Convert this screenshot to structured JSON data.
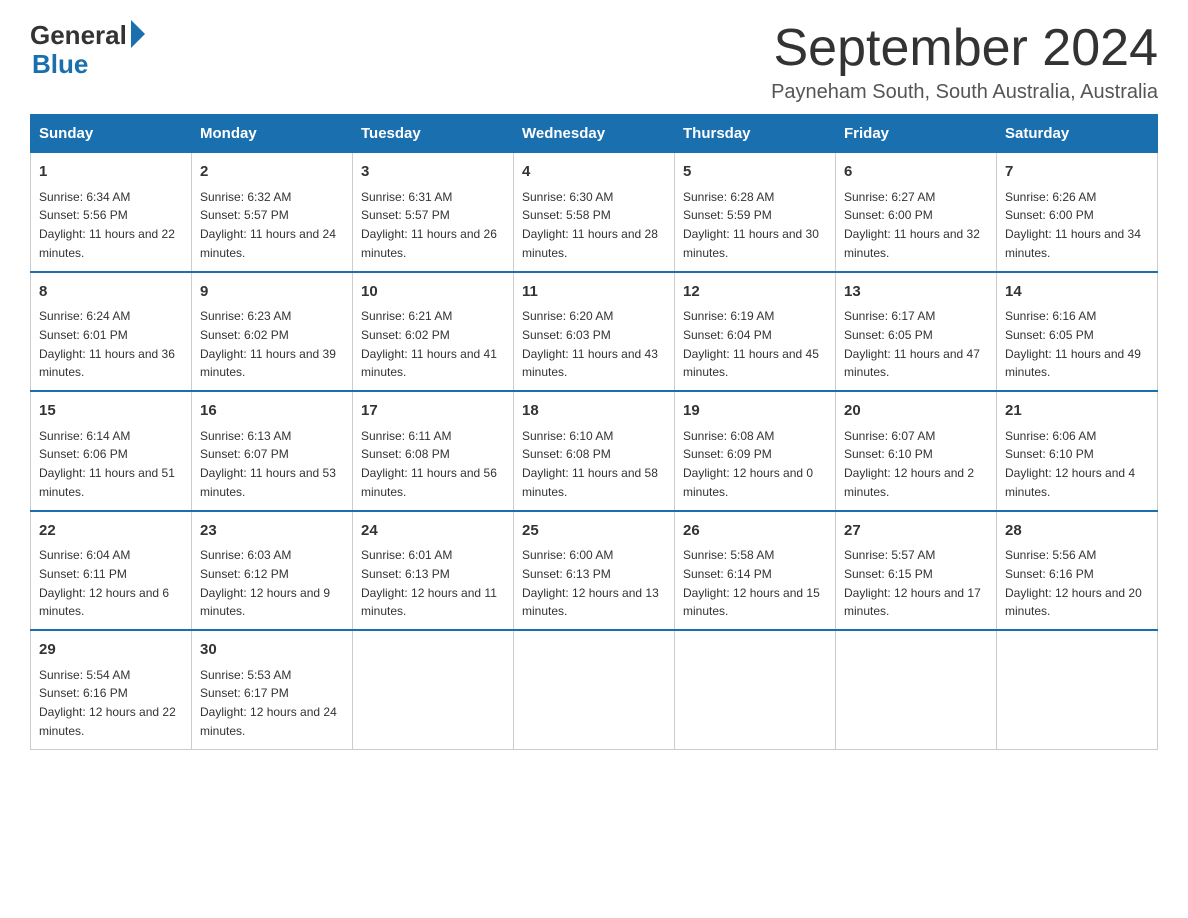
{
  "header": {
    "logo_general": "General",
    "logo_blue": "Blue",
    "title": "September 2024",
    "location": "Payneham South, South Australia, Australia"
  },
  "days_of_week": [
    "Sunday",
    "Monday",
    "Tuesday",
    "Wednesday",
    "Thursday",
    "Friday",
    "Saturday"
  ],
  "weeks": [
    [
      {
        "day": "1",
        "sunrise": "6:34 AM",
        "sunset": "5:56 PM",
        "daylight": "11 hours and 22 minutes."
      },
      {
        "day": "2",
        "sunrise": "6:32 AM",
        "sunset": "5:57 PM",
        "daylight": "11 hours and 24 minutes."
      },
      {
        "day": "3",
        "sunrise": "6:31 AM",
        "sunset": "5:57 PM",
        "daylight": "11 hours and 26 minutes."
      },
      {
        "day": "4",
        "sunrise": "6:30 AM",
        "sunset": "5:58 PM",
        "daylight": "11 hours and 28 minutes."
      },
      {
        "day": "5",
        "sunrise": "6:28 AM",
        "sunset": "5:59 PM",
        "daylight": "11 hours and 30 minutes."
      },
      {
        "day": "6",
        "sunrise": "6:27 AM",
        "sunset": "6:00 PM",
        "daylight": "11 hours and 32 minutes."
      },
      {
        "day": "7",
        "sunrise": "6:26 AM",
        "sunset": "6:00 PM",
        "daylight": "11 hours and 34 minutes."
      }
    ],
    [
      {
        "day": "8",
        "sunrise": "6:24 AM",
        "sunset": "6:01 PM",
        "daylight": "11 hours and 36 minutes."
      },
      {
        "day": "9",
        "sunrise": "6:23 AM",
        "sunset": "6:02 PM",
        "daylight": "11 hours and 39 minutes."
      },
      {
        "day": "10",
        "sunrise": "6:21 AM",
        "sunset": "6:02 PM",
        "daylight": "11 hours and 41 minutes."
      },
      {
        "day": "11",
        "sunrise": "6:20 AM",
        "sunset": "6:03 PM",
        "daylight": "11 hours and 43 minutes."
      },
      {
        "day": "12",
        "sunrise": "6:19 AM",
        "sunset": "6:04 PM",
        "daylight": "11 hours and 45 minutes."
      },
      {
        "day": "13",
        "sunrise": "6:17 AM",
        "sunset": "6:05 PM",
        "daylight": "11 hours and 47 minutes."
      },
      {
        "day": "14",
        "sunrise": "6:16 AM",
        "sunset": "6:05 PM",
        "daylight": "11 hours and 49 minutes."
      }
    ],
    [
      {
        "day": "15",
        "sunrise": "6:14 AM",
        "sunset": "6:06 PM",
        "daylight": "11 hours and 51 minutes."
      },
      {
        "day": "16",
        "sunrise": "6:13 AM",
        "sunset": "6:07 PM",
        "daylight": "11 hours and 53 minutes."
      },
      {
        "day": "17",
        "sunrise": "6:11 AM",
        "sunset": "6:08 PM",
        "daylight": "11 hours and 56 minutes."
      },
      {
        "day": "18",
        "sunrise": "6:10 AM",
        "sunset": "6:08 PM",
        "daylight": "11 hours and 58 minutes."
      },
      {
        "day": "19",
        "sunrise": "6:08 AM",
        "sunset": "6:09 PM",
        "daylight": "12 hours and 0 minutes."
      },
      {
        "day": "20",
        "sunrise": "6:07 AM",
        "sunset": "6:10 PM",
        "daylight": "12 hours and 2 minutes."
      },
      {
        "day": "21",
        "sunrise": "6:06 AM",
        "sunset": "6:10 PM",
        "daylight": "12 hours and 4 minutes."
      }
    ],
    [
      {
        "day": "22",
        "sunrise": "6:04 AM",
        "sunset": "6:11 PM",
        "daylight": "12 hours and 6 minutes."
      },
      {
        "day": "23",
        "sunrise": "6:03 AM",
        "sunset": "6:12 PM",
        "daylight": "12 hours and 9 minutes."
      },
      {
        "day": "24",
        "sunrise": "6:01 AM",
        "sunset": "6:13 PM",
        "daylight": "12 hours and 11 minutes."
      },
      {
        "day": "25",
        "sunrise": "6:00 AM",
        "sunset": "6:13 PM",
        "daylight": "12 hours and 13 minutes."
      },
      {
        "day": "26",
        "sunrise": "5:58 AM",
        "sunset": "6:14 PM",
        "daylight": "12 hours and 15 minutes."
      },
      {
        "day": "27",
        "sunrise": "5:57 AM",
        "sunset": "6:15 PM",
        "daylight": "12 hours and 17 minutes."
      },
      {
        "day": "28",
        "sunrise": "5:56 AM",
        "sunset": "6:16 PM",
        "daylight": "12 hours and 20 minutes."
      }
    ],
    [
      {
        "day": "29",
        "sunrise": "5:54 AM",
        "sunset": "6:16 PM",
        "daylight": "12 hours and 22 minutes."
      },
      {
        "day": "30",
        "sunrise": "5:53 AM",
        "sunset": "6:17 PM",
        "daylight": "12 hours and 24 minutes."
      },
      null,
      null,
      null,
      null,
      null
    ]
  ]
}
